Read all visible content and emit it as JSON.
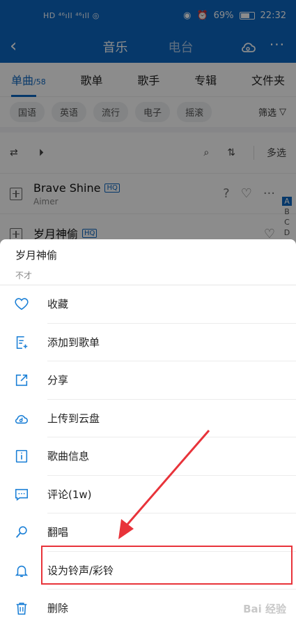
{
  "status_bar": {
    "left_indicators": "HD ⁴⁶ıll ⁴⁶ıll ◎",
    "battery": "69%",
    "time": "22:32"
  },
  "topbar": {
    "back_glyph": "‹",
    "tabs": [
      "音乐",
      "电台"
    ],
    "more_glyph": "···"
  },
  "subtabs": {
    "active_label": "单曲",
    "active_count": "/58",
    "items": [
      "歌单",
      "歌手",
      "专辑",
      "文件夹"
    ]
  },
  "filters": {
    "chips": [
      "国语",
      "英语",
      "流行",
      "电子",
      "摇滚"
    ],
    "filter_label": "筛选"
  },
  "toolbar": {
    "multi_select": "多选"
  },
  "songs": [
    {
      "title": "Brave Shine",
      "badge": "HQ",
      "artist": "Aimer"
    },
    {
      "title": "岁月神偷",
      "badge": "HQ",
      "artist": ""
    }
  ],
  "alpha_index": [
    "A",
    "B",
    "C",
    "D"
  ],
  "sheet": {
    "title": "岁月神偷",
    "subtitle": "不才",
    "items": [
      {
        "label": "收藏",
        "icon": "heart-icon"
      },
      {
        "label": "添加到歌单",
        "icon": "add-to-playlist-icon"
      },
      {
        "label": "分享",
        "icon": "share-icon"
      },
      {
        "label": "上传到云盘",
        "icon": "cloud-upload-icon"
      },
      {
        "label": "歌曲信息",
        "icon": "info-icon"
      },
      {
        "label": "评论(1w)",
        "icon": "comment-icon"
      },
      {
        "label": "翻唱",
        "icon": "microphone-icon"
      },
      {
        "label": "设为铃声/彩铃",
        "icon": "bell-icon"
      },
      {
        "label": "删除",
        "icon": "trash-icon"
      }
    ]
  },
  "colors": {
    "brand_blue": "#0b66c2",
    "icon_blue": "#1a7fd6",
    "annotation_red": "#e8333a"
  },
  "watermark": "Bai 经验"
}
